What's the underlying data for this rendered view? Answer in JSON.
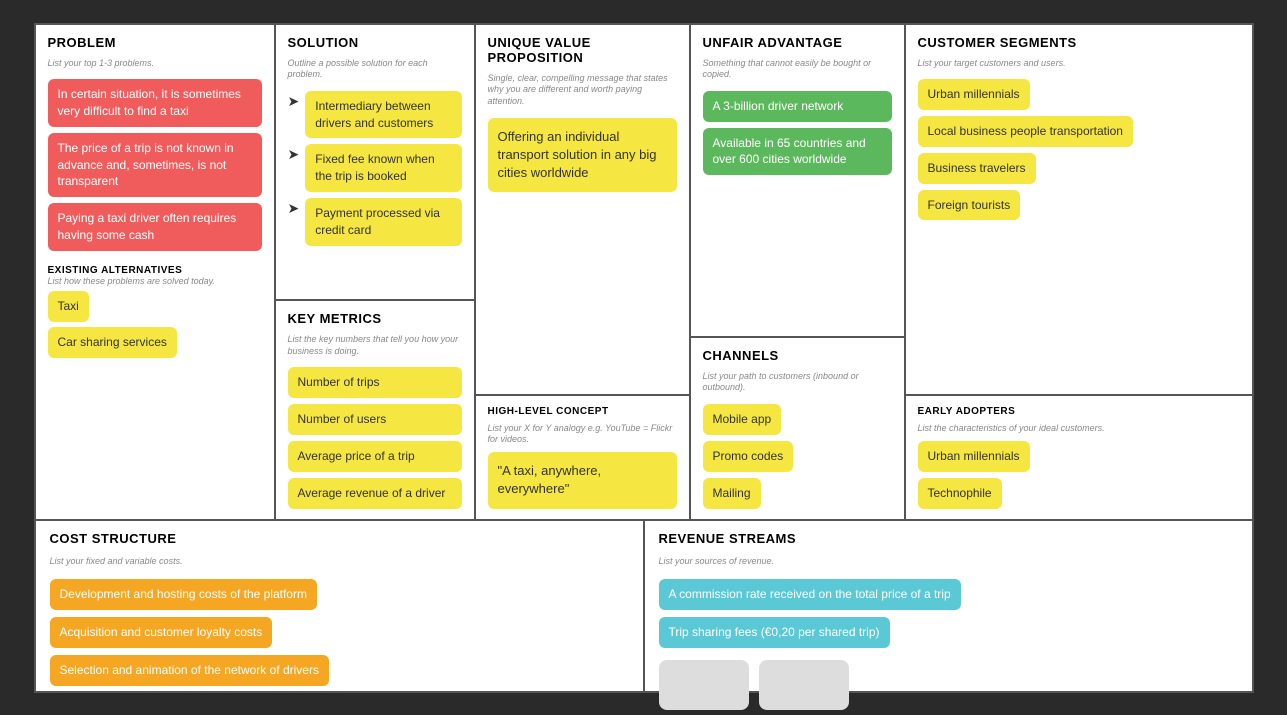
{
  "problem": {
    "title": "PROBLEM",
    "subtitle": "List your top 1-3 problems.",
    "items": [
      "In certain situation, it is sometimes very difficult to find a taxi",
      "The price of a trip is not known in advance and, sometimes, is not transparent",
      "Paying a taxi driver often requires having some cash"
    ],
    "existing_alt_title": "EXISTING ALTERNATIVES",
    "existing_alt_sub": "List how these problems are solved today.",
    "existing_items": [
      "Taxi",
      "Car sharing services"
    ]
  },
  "solution": {
    "title": "SOLUTION",
    "subtitle": "Outline a possible solution for each problem.",
    "items": [
      "Intermediary between drivers and customers",
      "Fixed fee known when the trip is booked",
      "Payment processed via credit card"
    ]
  },
  "uvp": {
    "title": "UNIQUE VALUE PROPOSITION",
    "subtitle": "Single, clear, compelling message that states why you are different and worth paying attention.",
    "main_tag": "Offering an individual transport solution in any big cities worldwide",
    "hlc_title": "HIGH-LEVEL CONCEPT",
    "hlc_sub": "List your X for Y analogy e.g. YouTube = Flickr for videos.",
    "hlc_tag": "\"A taxi, anywhere, everywhere\""
  },
  "key_metrics": {
    "title": "KEY METRICS",
    "subtitle": "List the key numbers that tell you how your business is doing.",
    "items": [
      "Number of trips",
      "Number of users",
      "Average price of a trip",
      "Average revenue of a driver"
    ]
  },
  "unfair": {
    "title": "UNFAIR ADVANTAGE",
    "subtitle": "Something that cannot easily be bought or copied.",
    "items_green": [
      "A 3-billion driver network",
      "Available in 65 countries and over 600 cities worldwide"
    ],
    "channels_title": "CHANNELS",
    "channels_sub": "List your path to customers (inbound or outbound).",
    "channels_items": [
      "Mobile app",
      "Promo codes",
      "Mailing"
    ]
  },
  "segments": {
    "title": "CUSTOMER SEGMENTS",
    "subtitle": "List your target customers and users.",
    "items": [
      "Urban millennials",
      "Local business people transportation",
      "Business travelers",
      "Foreign tourists"
    ],
    "early_title": "EARLY ADOPTERS",
    "early_sub": "List the characteristics of your ideal customers.",
    "early_items": [
      "Urban millennials",
      "Technophile"
    ]
  },
  "cost": {
    "title": "COST STRUCTURE",
    "subtitle": "List your fixed and variable costs.",
    "items": [
      "Development and hosting costs of the platform",
      "Acquisition and customer loyalty costs",
      "Selection and animation of the network of drivers"
    ]
  },
  "revenue": {
    "title": "REVENUE STREAMS",
    "subtitle": "List your sources of revenue.",
    "items": [
      "A commission rate received on the total price of a trip",
      "Trip sharing fees (€0,20 per shared trip)"
    ]
  }
}
